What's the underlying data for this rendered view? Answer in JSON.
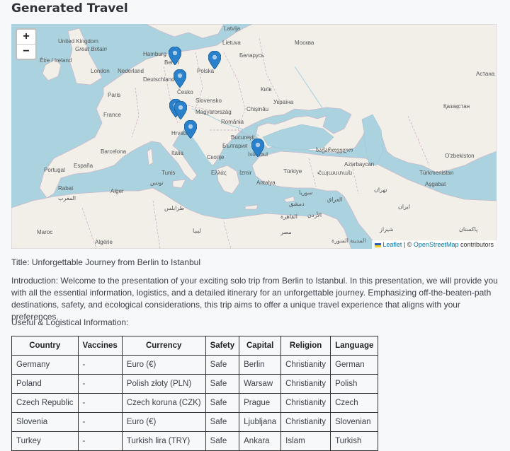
{
  "page": {
    "title": "Generated Travel"
  },
  "map": {
    "zoom_in": "+",
    "zoom_out": "−",
    "attribution": {
      "leaflet": "Leaflet",
      "separator": " | © ",
      "osm": "OpenStreetMap",
      "suffix": " contributors"
    },
    "labels": [
      "United Kingdom",
      "Great Britain",
      "Éire / Ireland",
      "London",
      "Hamburg",
      "Berlin",
      "Nederland",
      "Deutschland",
      "Polska",
      "Česko",
      "Paris",
      "France",
      "Latvija",
      "Lietuva",
      "Беларусь",
      "Москва",
      "Київ",
      "Україна",
      "Chișinău",
      "Magyarország",
      "Slovensko",
      "România",
      "Hrvatska",
      "Bucureşti",
      "България",
      "İstanbul",
      "Barcelona",
      "España",
      "Portugal",
      "Italia",
      "Ελλάς",
      "İzmir",
      "Türkiye",
      "Antalya",
      "Rabat",
      "المغرب",
      "Alger",
      "تونس",
      "Maroc",
      "Algérie",
      "طرابلس",
      "ليبيا",
      "القاهرة",
      "مصر",
      "Астана",
      "Қазақстан",
      "Azərbaycan",
      "Հայաստան",
      "საქართველო",
      "Türkmenistan",
      "O'zbekiston",
      "Aşgabat",
      "تهران",
      "ایران",
      "العراق",
      "سوريا",
      "دمشق",
      "الأردن",
      "شيراز",
      "پاکستان",
      "المدينة المنورة",
      "Скопје",
      "Tunis"
    ],
    "markers": [
      "Berlin",
      "Warsaw",
      "Prague",
      "Ljubljana",
      "Zagreb",
      "Split",
      "Istanbul"
    ]
  },
  "content": {
    "title_line": "Title: Unforgettable Journey from Berlin to Istanbul",
    "introduction": "Introduction: Welcome to the presentation of your exciting solo trip from Berlin to Istanbul. In this presentation, we will provide you with all the essential information, logistics, and a detailed itinerary for an unforgettable journey. Emphasizing off-the-beaten-path destinations, safety, and ecological considerations, this trip aims to offer a unique travel experience that aligns with your preferences.",
    "useful_heading": "Useful & Logistical Information:"
  },
  "table": {
    "headers": [
      "Country",
      "Vaccines",
      "Currency",
      "Safety",
      "Capital",
      "Religion",
      "Language"
    ],
    "rows": [
      [
        "Germany",
        "-",
        "Euro (€)",
        "Safe",
        "Berlin",
        "Christianity",
        "German"
      ],
      [
        "Poland",
        "-",
        "Polish złoty (PLN)",
        "Safe",
        "Warsaw",
        "Christianity",
        "Polish"
      ],
      [
        "Czech Republic",
        "-",
        "Czech koruna (CZK)",
        "Safe",
        "Prague",
        "Christianity",
        "Czech"
      ],
      [
        "Slovenia",
        "-",
        "Euro (€)",
        "Safe",
        "Ljubljana",
        "Christianity",
        "Slovenian"
      ],
      [
        "Turkey",
        "-",
        "Turkish lira (TRY)",
        "Safe",
        "Ankara",
        "Islam",
        "Turkish"
      ]
    ]
  }
}
